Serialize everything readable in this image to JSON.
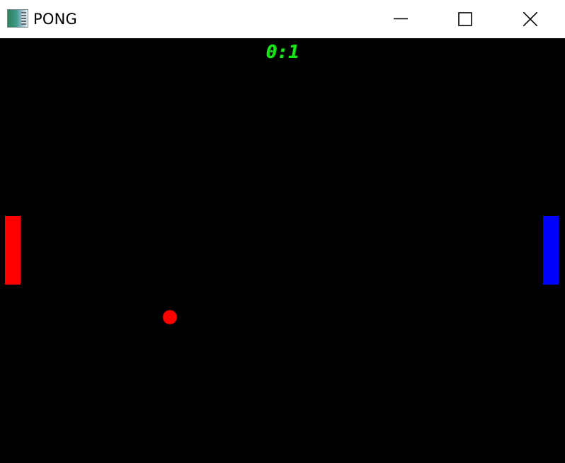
{
  "window": {
    "title": "PONG",
    "icon": "app-window-icon",
    "controls": {
      "minimize_icon": "minimize-icon",
      "maximize_icon": "maximize-icon",
      "close_icon": "close-icon"
    }
  },
  "game": {
    "score_text": "0:1",
    "score_left": 0,
    "score_right": 1,
    "colors": {
      "background": "#000000",
      "score": "#19e619",
      "left_paddle": "#ff0000",
      "right_paddle": "#0000ff",
      "ball": "#ff0000"
    }
  }
}
